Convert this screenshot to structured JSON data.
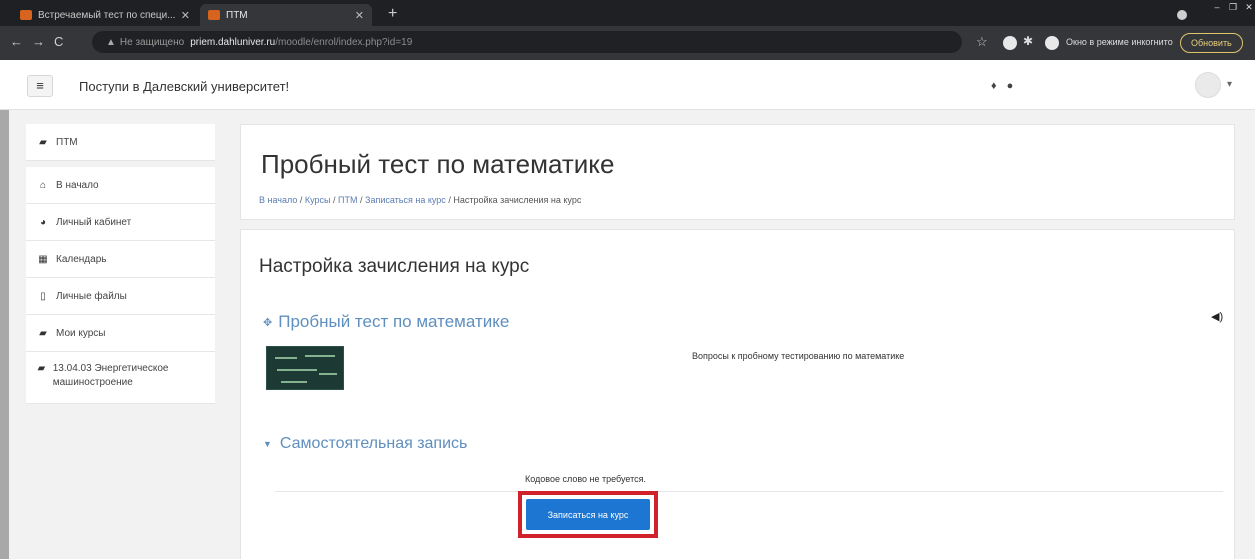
{
  "browser": {
    "tabs": [
      {
        "title": "Встречаемый тест по специ...",
        "active": false
      },
      {
        "title": "ПТМ",
        "active": true
      }
    ],
    "url": {
      "warning": "Не защищено",
      "host": "priem.dahluniver.ru",
      "path": "/moodle/enrol/index.php?id=19"
    },
    "incognito_label": "Окно в режиме инкогнито",
    "update_button": "Обновить"
  },
  "navbar": {
    "site_name": "Поступи в Далевский университет!",
    "menu_icon": "hamburger-icon"
  },
  "drawer": {
    "items": [
      {
        "label": "ПТМ",
        "icon": "graduation-cap-icon"
      },
      {
        "label": "В начало",
        "icon": "home-icon"
      },
      {
        "label": "Личный кабинет",
        "icon": "dashboard-icon"
      },
      {
        "label": "Календарь",
        "icon": "calendar-icon"
      },
      {
        "label": "Личные файлы",
        "icon": "file-icon"
      },
      {
        "label": "Мои курсы",
        "icon": "graduation-cap-icon"
      },
      {
        "label": "13.04.03 Энергетическое машиностроение",
        "icon": "graduation-cap-icon"
      }
    ]
  },
  "header": {
    "title": "Пробный тест по математике",
    "breadcrumb": [
      "В начало",
      "Курсы",
      "ПТМ",
      "Записаться на курс",
      "Настройка зачисления на курс"
    ]
  },
  "enrol": {
    "section_title": "Настройка зачисления на курс",
    "course_name": "Пробный тест по математике",
    "course_summary": "Вопросы к пробному тестированию по математике",
    "self_enrol_title": "Самостоятельная запись",
    "keyword_note": "Кодовое слово не требуется.",
    "enrol_button": "Записаться на курс"
  },
  "colors": {
    "link": "#5f8fbf",
    "button": "#1c76d2",
    "highlight": "#d1222c"
  }
}
